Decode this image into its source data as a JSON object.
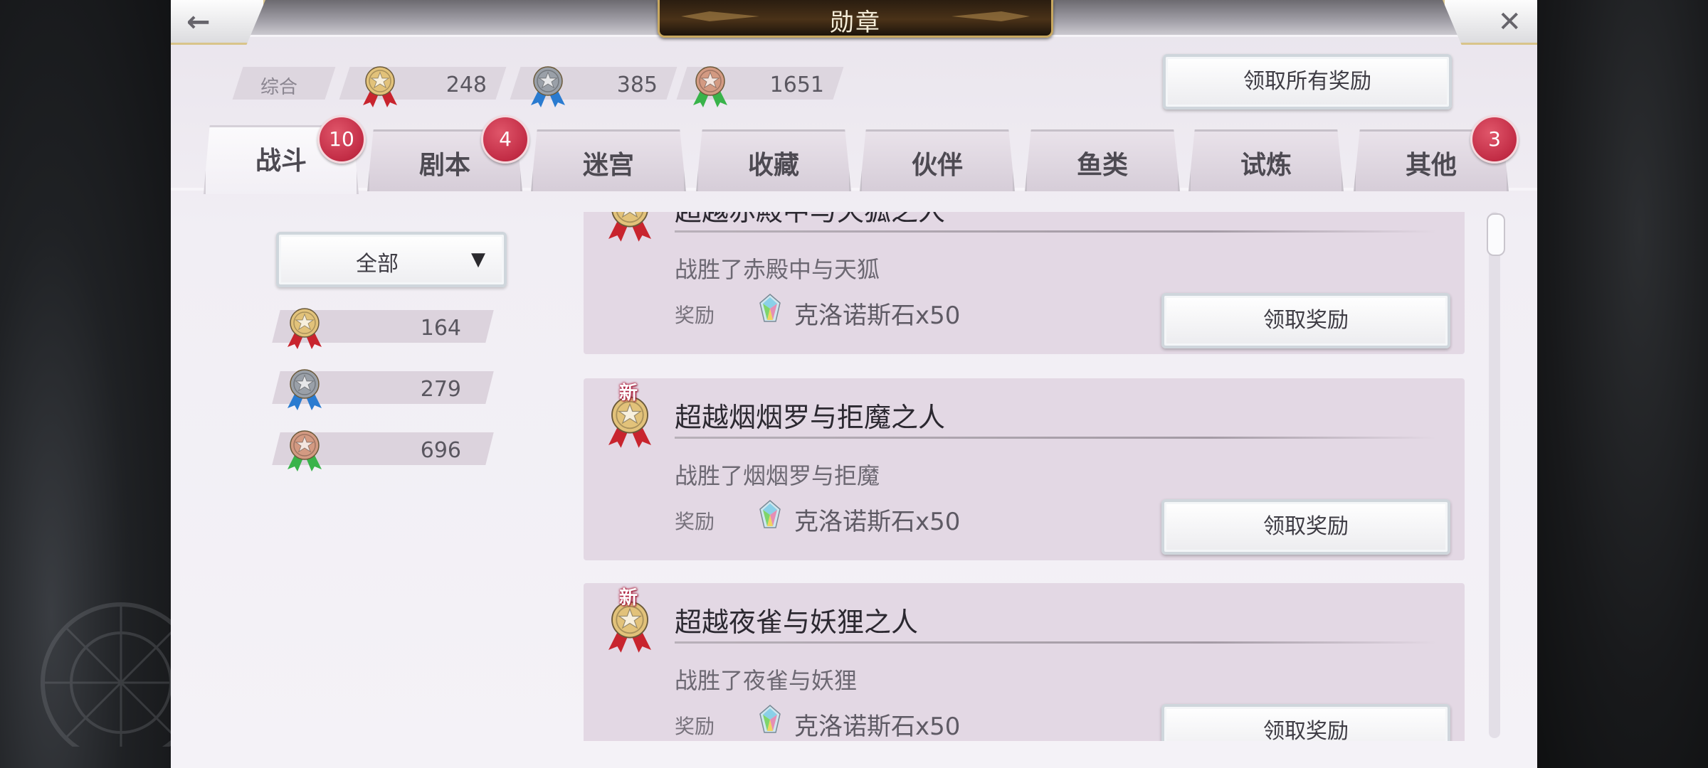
{
  "window": {
    "title": "勋章"
  },
  "summary": {
    "label": "综合",
    "gold": "248",
    "silver": "385",
    "bronze": "1651",
    "claim_all_label": "领取所有奖励"
  },
  "tabs": [
    {
      "label": "战斗",
      "badge": "10",
      "active": true
    },
    {
      "label": "剧本",
      "badge": "4"
    },
    {
      "label": "迷宫"
    },
    {
      "label": "收藏"
    },
    {
      "label": "伙伴"
    },
    {
      "label": "鱼类"
    },
    {
      "label": "试炼"
    },
    {
      "label": "其他",
      "badge": "3"
    }
  ],
  "filter": {
    "value": "全部"
  },
  "counts": {
    "gold": "164",
    "silver": "279",
    "bronze": "696"
  },
  "achievements": [
    {
      "title": "超越赤殿中与天狐之人",
      "desc": "战胜了赤殿中与天狐",
      "reward_label": "奖励",
      "reward": "克洛诺斯石x50",
      "button": "领取奖励",
      "new_tag": ""
    },
    {
      "title": "超越烟烟罗与拒魔之人",
      "desc": "战胜了烟烟罗与拒魔",
      "reward_label": "奖励",
      "reward": "克洛诺斯石x50",
      "button": "领取奖励",
      "new_tag": "新"
    },
    {
      "title": "超越夜雀与妖狸之人",
      "desc": "战胜了夜雀与妖狸",
      "reward_label": "奖励",
      "reward": "克洛诺斯石x50",
      "button": "领取奖励",
      "new_tag": "新"
    }
  ],
  "colors": {
    "gold": "#e2c27a",
    "silver": "#9aa0a8",
    "bronze": "#d39a82",
    "ribbon_red": "#c8242e",
    "ribbon_blue": "#2a7bd0",
    "ribbon_green": "#39b34a",
    "badge": "#c22c45"
  }
}
